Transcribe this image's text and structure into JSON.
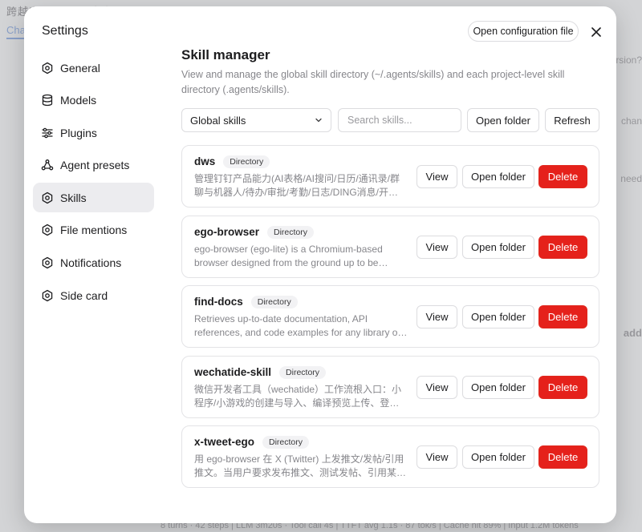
{
  "background": {
    "app_title": "跨越实习驱动VO自身",
    "tab": "Chat",
    "right_texts": [
      "ersion?",
      "chan",
      "need",
      "add"
    ],
    "footer": "8 turns · 42 steps  |  LLM 3m20s · Tool call 4s  |  TTFT avg 1.1s · 87 tok/s  |  Cache hit 89%  |  Input 1.2M tokens"
  },
  "modal": {
    "title": "Settings",
    "open_config_label": "Open configuration file",
    "close_icon": "close-icon"
  },
  "nav": {
    "items": [
      {
        "label": "General",
        "icon": "gear-icon",
        "active": false
      },
      {
        "label": "Models",
        "icon": "database-icon",
        "active": false
      },
      {
        "label": "Plugins",
        "icon": "sliders-icon",
        "active": false
      },
      {
        "label": "Agent presets",
        "icon": "agent-icon",
        "active": false
      },
      {
        "label": "Skills",
        "icon": "gear-icon",
        "active": true
      },
      {
        "label": "File mentions",
        "icon": "gear-icon",
        "active": false
      },
      {
        "label": "Notifications",
        "icon": "gear-icon",
        "active": false
      },
      {
        "label": "Side card",
        "icon": "gear-icon",
        "active": false
      }
    ]
  },
  "skills": {
    "title": "Skill manager",
    "description": "View and manage the global skill directory (~/.agents/skills) and each project-level skill directory (.agents/skills).",
    "scope_select": "Global skills",
    "search_placeholder": "Search skills...",
    "open_folder_label": "Open folder",
    "refresh_label": "Refresh",
    "items": [
      {
        "name": "dws",
        "badge": "Directory",
        "description": "管理钉钉产品能力(AI表格/AI搜问/日历/通讯录/群聊与机器人/待办/审批/考勤/日志/DING消息/开放平台等)",
        "view_label": "View",
        "open_label": "Open folder",
        "delete_label": "Delete"
      },
      {
        "name": "ego-browser",
        "badge": "Directory",
        "description": "ego-browser (ego-lite) is a Chromium-based browser designed from the ground up to be operated by agents",
        "view_label": "View",
        "open_label": "Open folder",
        "delete_label": "Delete"
      },
      {
        "name": "find-docs",
        "badge": "Directory",
        "description": "Retrieves up-to-date documentation, API references, and code examples for any library or framework",
        "view_label": "View",
        "open_label": "Open folder",
        "delete_label": "Delete"
      },
      {
        "name": "wechatide-skill",
        "badge": "Directory",
        "description": "微信开发者工具（wechatide）工作流根入口：小程序/小游戏的创建与导入、编译预览上传、登录与调试",
        "view_label": "View",
        "open_label": "Open folder",
        "delete_label": "Delete"
      },
      {
        "name": "x-tweet-ego",
        "badge": "Directory",
        "description": "用 ego-browser 在 X (Twitter) 上发推文/发帖/引用推文。当用户要求发布推文、测试发帖、引用某条推文时使用",
        "view_label": "View",
        "open_label": "Open folder",
        "delete_label": "Delete"
      }
    ]
  },
  "colors": {
    "delete": "#e5211b",
    "active_nav": "#ececef",
    "muted_text": "#86868b"
  }
}
